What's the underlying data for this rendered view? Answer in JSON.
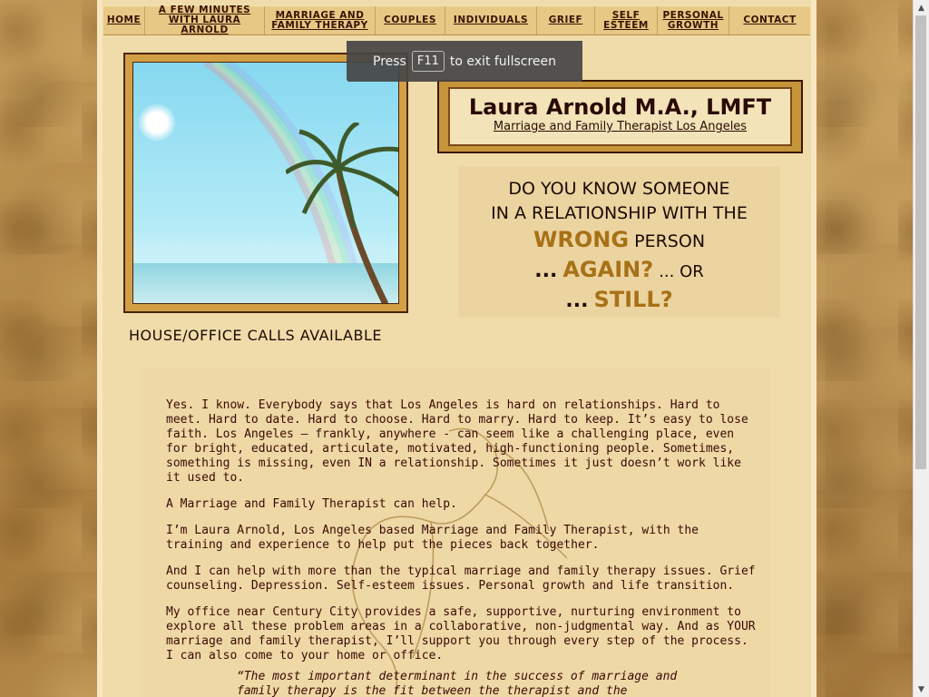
{
  "nav": {
    "items": [
      {
        "label": "HOME"
      },
      {
        "label": "A FEW MINUTES\nWITH LAURA ARNOLD"
      },
      {
        "label": "MARRIAGE AND\nFAMILY THERAPY"
      },
      {
        "label": "COUPLES"
      },
      {
        "label": "INDIVIDUALS"
      },
      {
        "label": "GRIEF"
      },
      {
        "label": "SELF\nESTEEM"
      },
      {
        "label": "PERSONAL\nGROWTH"
      },
      {
        "label": "CONTACT"
      }
    ]
  },
  "toast": {
    "press": "Press",
    "key": "F11",
    "suffix": "to exit fullscreen"
  },
  "photo": {
    "caption": "HOUSE/OFFICE CALLS AVAILABLE"
  },
  "plaque": {
    "name": "Laura Arnold M.A., LMFT",
    "subtitle": "Marriage and Family Therapist Los Angeles"
  },
  "headline": {
    "line1": "DO YOU KNOW SOMEONE",
    "line2": "IN A RELATIONSHIP WITH THE",
    "wrong": "WRONG",
    "person": "PERSON",
    "dots1": "...",
    "again": "AGAIN?",
    "or": "... OR",
    "dots2": "...",
    "still": "STILL?"
  },
  "body": {
    "paragraphs": [
      "Yes. I know. Everybody says that Los Angeles is hard on relationships. Hard to meet. Hard to date. Hard to choose. Hard to marry. Hard to keep. It’s easy to lose faith. Los Angeles – frankly, anywhere - can seem like a challenging place, even for bright, educated, articulate, motivated, high-functioning people. Sometimes, something is missing, even IN a relationship. Sometimes it just doesn’t work like it used to.",
      "A Marriage and Family Therapist can help.",
      "I’m Laura Arnold, Los Angeles based Marriage and Family Therapist, with the training and experience to help put the pieces back together.",
      "And I can help with more than the typical marriage and family therapy issues. Grief counseling. Depression. Self-esteem issues. Personal growth and life transition.",
      "My office near Century City provides a safe, supportive, nurturing environment to explore all these problem areas in a collaborative, non-judgmental way. And as YOUR marriage and family therapist, I’ll support you through every step of the process. I can also come to your home or office."
    ],
    "quote": "“The most important determinant in the success of marriage and family therapy is the fit between the therapist and the client.”"
  },
  "colors": {
    "accent": "#a77116",
    "text": "#3a0a05",
    "nav_bg": "#e7c985",
    "page_bg": "#f0dcaa"
  }
}
